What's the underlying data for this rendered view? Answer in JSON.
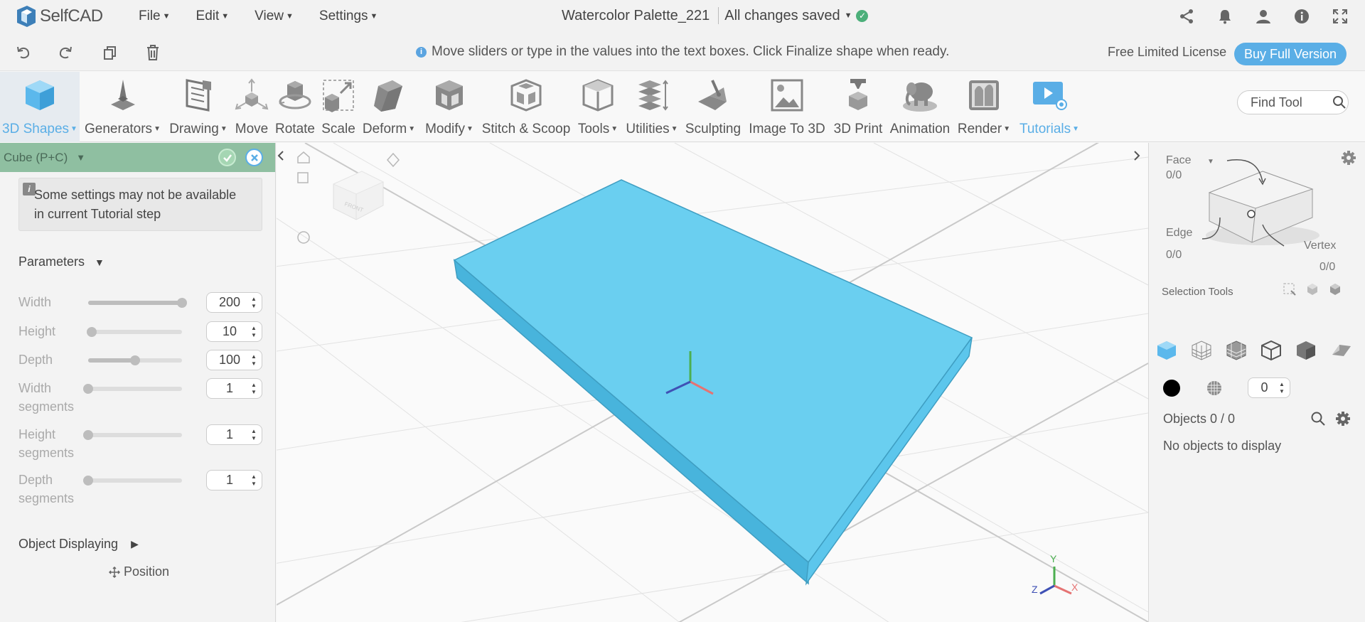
{
  "app": {
    "logo_text": "SelfCAD",
    "menu": [
      {
        "label": "File"
      },
      {
        "label": "Edit"
      },
      {
        "label": "View"
      },
      {
        "label": "Settings"
      }
    ],
    "document_title": "Watercolor Palette_221",
    "save_status": "All changes saved",
    "top_icons": [
      "share-icon",
      "bell-icon",
      "user-icon",
      "info-icon",
      "fullscreen-icon"
    ]
  },
  "actionbar": {
    "icons": [
      "undo-icon",
      "redo-icon",
      "copy-icon",
      "trash-icon"
    ],
    "hint": "Move sliders or type in the values into the text boxes. Click Finalize shape when ready.",
    "license": "Free Limited License",
    "buy_label": "Buy Full Version"
  },
  "toolbar": {
    "tools": [
      {
        "label": "3D Shapes",
        "dropdown": true
      },
      {
        "label": "Generators",
        "dropdown": true
      },
      {
        "label": "Drawing",
        "dropdown": true
      },
      {
        "label": "Move",
        "dropdown": false
      },
      {
        "label": "Rotate",
        "dropdown": false
      },
      {
        "label": "Scale",
        "dropdown": false
      },
      {
        "label": "Deform",
        "dropdown": true
      },
      {
        "label": "Modify",
        "dropdown": true
      },
      {
        "label": "Stitch & Scoop",
        "dropdown": false
      },
      {
        "label": "Tools",
        "dropdown": true
      },
      {
        "label": "Utilities",
        "dropdown": true
      },
      {
        "label": "Sculpting",
        "dropdown": false
      },
      {
        "label": "Image To 3D",
        "dropdown": false
      },
      {
        "label": "3D Print",
        "dropdown": false
      },
      {
        "label": "Animation",
        "dropdown": false
      },
      {
        "label": "Render",
        "dropdown": true
      },
      {
        "label": "Tutorials",
        "dropdown": true
      }
    ],
    "find_placeholder": "Find Tool"
  },
  "left_panel": {
    "title": "Cube (P+C)",
    "notice": "Some settings may not be available in current Tutorial step",
    "parameters_title": "Parameters",
    "params": [
      {
        "label": "Width",
        "value": "200",
        "fraction": 1.0
      },
      {
        "label": "Height",
        "value": "10",
        "fraction": 0.04
      },
      {
        "label": "Depth",
        "value": "100",
        "fraction": 0.5
      },
      {
        "label": "Width segments",
        "value": "1",
        "fraction": 0.0
      },
      {
        "label": "Height segments",
        "value": "1",
        "fraction": 0.0
      },
      {
        "label": "Depth segments",
        "value": "1",
        "fraction": 0.0
      }
    ],
    "object_displaying_title": "Object Displaying",
    "position_label": "Position"
  },
  "right_panel": {
    "face_label": "Face",
    "face_count": "0/0",
    "edge_label": "Edge",
    "edge_count": "0/0",
    "vertex_label": "Vertex",
    "vertex_count": "0/0",
    "selection_tools_label": "Selection Tools",
    "brush_value": "0",
    "objects_title": "Objects 0 / 0",
    "no_objects": "No objects to display"
  },
  "viewport": {
    "axis_labels": {
      "x": "X",
      "y": "Y",
      "z": "Z"
    },
    "shape_color": "#6acff0"
  },
  "colors": {
    "accent": "#5aaee6",
    "panel_header": "#8fbfa1",
    "ok": "#a5d6b3"
  }
}
